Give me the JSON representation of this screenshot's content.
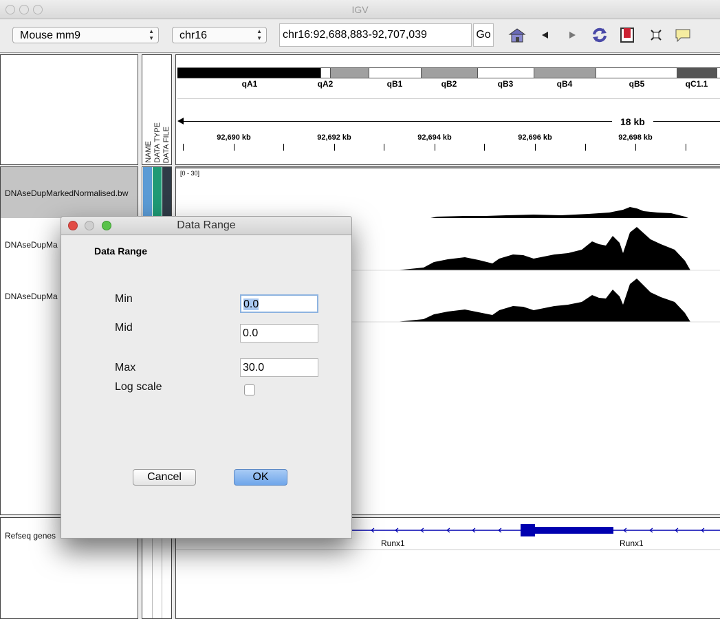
{
  "window": {
    "title": "IGV"
  },
  "toolbar": {
    "genome": "Mouse mm9",
    "chromosome": "chr16",
    "locus": "chr16:92,688,883-92,707,039",
    "go_label": "Go",
    "icons": [
      "home-icon",
      "back-icon",
      "forward-icon",
      "refresh-icon",
      "region-of-interest-icon",
      "fit-window-icon",
      "popup-info-icon"
    ]
  },
  "header": {
    "attribute_columns": [
      "NAME",
      "DATA TYPE",
      "DATA FILE"
    ],
    "cytobands": [
      "qA1",
      "qA2",
      "qB1",
      "qB2",
      "qB3",
      "qB4",
      "qB5",
      "qC1.1"
    ],
    "span_label": "18 kb",
    "ruler_ticks": [
      "92,690 kb",
      "92,692 kb",
      "92,694 kb",
      "92,696 kb",
      "92,698 kb"
    ]
  },
  "tracks": {
    "track1_name": "DNAseDupMarkedNormalised.bw",
    "track2_name": "DNAseDupMa",
    "track3_name": "DNAseDupMa",
    "data_range_label": "[0 - 30]",
    "refseq_name": "Refseq genes",
    "gene_label_1": "Runx1",
    "gene_label_2": "Runx1"
  },
  "colors": {
    "attr_name": "#5b9bd5",
    "attr_type": "#1f9a75",
    "attr_file": "#2f3b47",
    "gene": "#0000b0",
    "ok_button": "#7fb1ef"
  },
  "dialog": {
    "title": "Data Range",
    "heading": "Data Range",
    "min_label": "Min",
    "min_value": "0.0",
    "mid_label": "Mid",
    "mid_value": "0.0",
    "max_label": "Max",
    "max_value": "30.0",
    "log_scale_label": "Log scale",
    "log_scale_checked": false,
    "cancel_label": "Cancel",
    "ok_label": "OK"
  }
}
